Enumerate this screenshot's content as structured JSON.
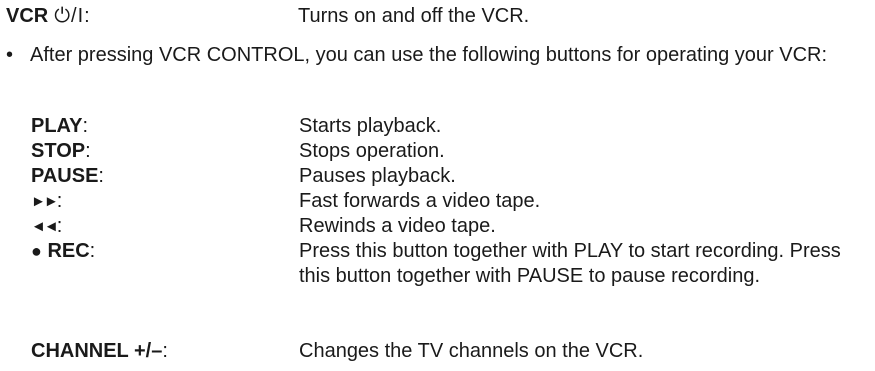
{
  "vcr_power": {
    "term": "VCR",
    "glyph": "⏻/I",
    "colon": ":",
    "description": "Turns on and off the VCR."
  },
  "bullet": {
    "marker": "•",
    "text": "After pressing VCR CONTROL, you can use the following buttons for operating your VCR:"
  },
  "buttons": [
    {
      "term": "PLAY",
      "colon": ":",
      "description": "Starts playback."
    },
    {
      "term": "STOP",
      "colon": ":",
      "description": "Stops operation."
    },
    {
      "term": "PAUSE",
      "colon": ":",
      "description": "Pauses playback."
    },
    {
      "term": "►►",
      "colon": ":",
      "description": "Fast forwards a video tape."
    },
    {
      "term": "◄◄",
      "colon": ":",
      "description": "Rewinds a video tape."
    },
    {
      "term": "REC",
      "prefix": "●",
      "colon": ":",
      "description": "Press this button together with PLAY to start recording. Press this button together with PAUSE to pause recording."
    },
    {
      "term": "CHANNEL +/–",
      "colon": ":",
      "description": "Changes the TV channels on the VCR."
    }
  ]
}
